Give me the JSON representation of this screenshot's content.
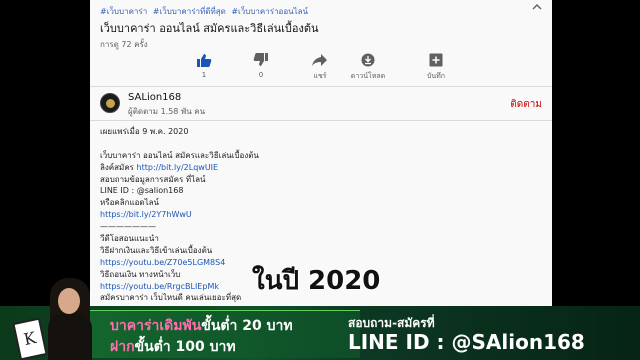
{
  "video": {
    "hashtags": [
      "#เว็บบาคาร่า",
      "#เว็บบาคาร่าที่ดีที่สุด",
      "#เว็บบาคาร่าออนไลน์"
    ],
    "title": "เว็บบาคาร่า ออนไลน์ สมัครและวิธีเล่นเบื้องต้น",
    "views": "การดู 72 ครั้ง"
  },
  "actions": {
    "like_count": "1",
    "dislike_count": "0",
    "share_label": "แชร์",
    "download_label": "ดาวน์โหลด",
    "save_label": "บันทึก"
  },
  "channel": {
    "name": "SALion168",
    "subscribers": "ผู้ติดตาม 1.58 พัน คน",
    "subscribe_label": "ติดตาม"
  },
  "description": {
    "published": "เผยแพร่เมื่อ 9 พ.ค. 2020",
    "lines": [
      {
        "text": "เว็บบาคาร่า ออนไลน์ สมัครและวิธีเล่นเบื้องต้น",
        "link": ""
      },
      {
        "text": "ลิงค์สมัคร ",
        "link": "http://bit.ly/2LqwUIE"
      },
      {
        "text": "สอบถามข้อมูลการสมัคร ที่ไลน์",
        "link": ""
      },
      {
        "text": "LINE ID : @salion168",
        "link": ""
      },
      {
        "text": "หรือคลิกแอดไลน์",
        "link": ""
      },
      {
        "text": "",
        "link": "https://bit.ly/2Y7hWwU"
      },
      {
        "text": "———————",
        "link": ""
      },
      {
        "text": "วีดีโอสอนแนะนำ",
        "link": ""
      },
      {
        "text": "วิธีฝากเงินและวิธีเข้าเล่นเบื้องต้น",
        "link": ""
      },
      {
        "text": "",
        "link": "https://youtu.be/Z70e5LGM8S4"
      },
      {
        "text": "วิธีถอนเงิน ทางหน้าเว็บ",
        "link": ""
      },
      {
        "text": "",
        "link": "https://youtu.be/RrgcBLIEpMk"
      },
      {
        "text": "สมัครบาคาร่า เว็บไหนดี คนเล่นเยอะที่สุด",
        "link": ""
      }
    ]
  },
  "overlay": {
    "year_text": "ในปี 2020"
  },
  "banner": {
    "promo_line1_a": "บาคาร่าเดิมพัน",
    "promo_line1_b": "ขั้นต่ำ 20 บาท",
    "promo_line2_a": "ฝาก",
    "promo_line2_b": "ขั้นต่ำ 100 บาท",
    "contact_label": "สอบถาม-สมัครที่",
    "line_id": "LINE ID : @SAlion168"
  },
  "colors": {
    "link": "#1a56b8",
    "subscribe": "#cc0000",
    "banner_green": "#12502a",
    "highlight_pink": "#ff6fb0"
  }
}
